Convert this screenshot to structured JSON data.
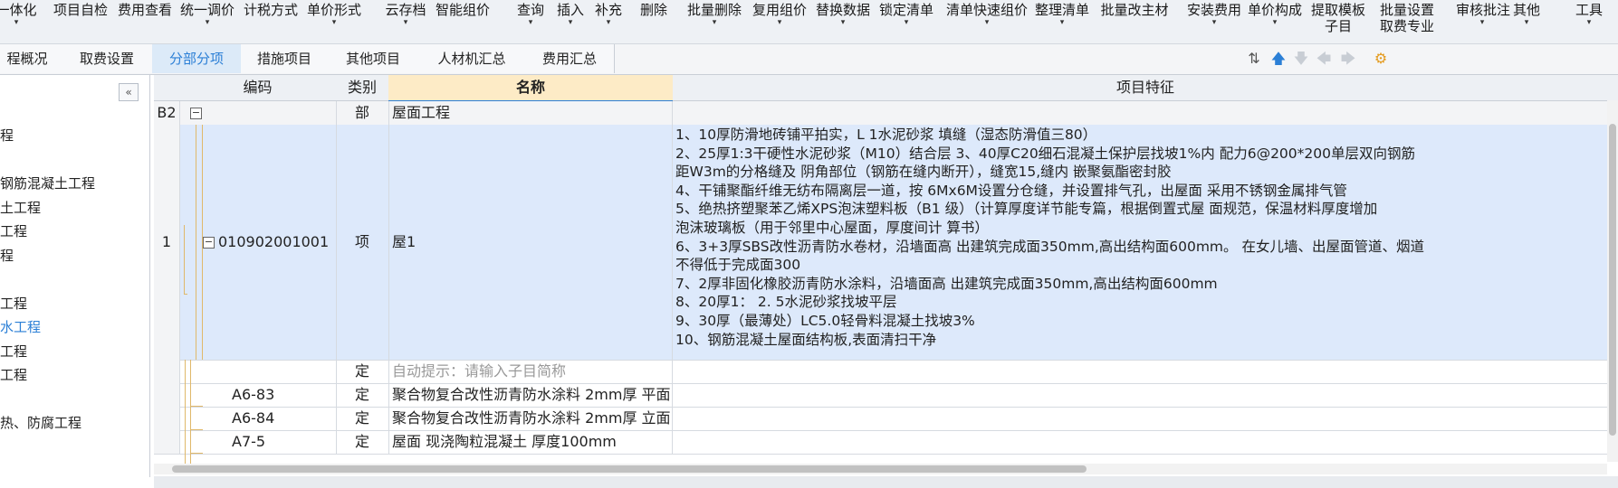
{
  "toolbar": {
    "items": [
      {
        "label": "一体化",
        "caret": true
      },
      {
        "label": "项目自检",
        "caret": false
      },
      {
        "label": "费用查看",
        "caret": false
      },
      {
        "label": "统一调价",
        "caret": true
      },
      {
        "label": "计税方式",
        "caret": false
      },
      {
        "label": "单价形式",
        "caret": true
      },
      {
        "label": "云存档",
        "caret": true
      },
      {
        "label": "智能组价",
        "caret": false
      },
      {
        "label": "查询",
        "caret": true
      },
      {
        "label": "插入",
        "caret": true
      },
      {
        "label": "补充",
        "caret": true
      },
      {
        "label": "删除",
        "caret": false
      },
      {
        "label": "批量删除",
        "caret": true
      },
      {
        "label": "复用组价",
        "caret": true
      },
      {
        "label": "替换数据",
        "caret": true
      },
      {
        "label": "锁定清单",
        "caret": true
      },
      {
        "label": "清单快速组价",
        "caret": true
      },
      {
        "label": "整理清单",
        "caret": true
      },
      {
        "label": "批量改主材",
        "caret": false
      },
      {
        "label": "安装费用",
        "caret": true
      },
      {
        "label": "单价构成",
        "caret": true
      },
      {
        "label": "提取模板",
        "label2": "子目",
        "caret": false
      },
      {
        "label": "批量设置",
        "label2": "取费专业",
        "caret": false
      },
      {
        "label": "审核批注",
        "caret": true
      },
      {
        "label": "其他",
        "caret": true
      },
      {
        "label": "工具",
        "caret": true
      }
    ]
  },
  "tabs": [
    {
      "label": "程概况",
      "active": false
    },
    {
      "label": "取费设置",
      "active": false
    },
    {
      "label": "分部分项",
      "active": true
    },
    {
      "label": "措施项目",
      "active": false
    },
    {
      "label": "其他项目",
      "active": false
    },
    {
      "label": "人材机汇总",
      "active": false
    },
    {
      "label": "费用汇总",
      "active": false
    }
  ],
  "tab_tools": {
    "sort_icon": "⇅",
    "up_icon": "🡅",
    "down_icon": "🡇",
    "left_icon": "🡄",
    "right_icon": "🡆",
    "settings_icon": "⚙"
  },
  "tree": {
    "collapse_symbol": "«",
    "items": [
      {
        "label": "程",
        "selected": false
      },
      {
        "label": "",
        "selected": false
      },
      {
        "label": "钢筋混凝土工程",
        "selected": false
      },
      {
        "label": "土工程",
        "selected": false
      },
      {
        "label": "工程",
        "selected": false
      },
      {
        "label": "程",
        "selected": false
      },
      {
        "label": "",
        "selected": false
      },
      {
        "label": "工程",
        "selected": false
      },
      {
        "label": "水工程",
        "selected": true
      },
      {
        "label": "工程",
        "selected": false
      },
      {
        "label": "工程",
        "selected": false
      },
      {
        "label": "",
        "selected": false
      },
      {
        "label": "热、防腐工程",
        "selected": false
      }
    ]
  },
  "grid": {
    "headers": {
      "code": "编码",
      "type": "类别",
      "name": "名称",
      "feature": "项目特征"
    },
    "rows": [
      {
        "num": "B2",
        "code": "",
        "type": "部",
        "name": "屋面工程",
        "kind": "section",
        "features": []
      },
      {
        "num": "1",
        "code": "010902001001",
        "type": "项",
        "name": "屋1",
        "kind": "item",
        "features": [
          "1、10厚防滑地砖铺平拍实，L 1水泥砂浆 填缝（湿态防滑值三80）",
          "2、25厚1:3干硬性水泥砂浆（M10）结合层 3、40厚C20细石混凝土保护层找坡1%内 配力6@200*200单层双向钢筋",
          "距W3m的分格缝及 阴角部位（钢筋在缝内断开），缝宽15,缝内 嵌聚氨酯密封胶",
          "4、干铺聚酯纤维无纺布隔离层一道，按 6Mx6M设置分仓缝，并设置排气孔，出屋面 采用不锈钢金属排气管",
          "5、绝热挤塑聚苯乙烯XPS泡沫塑料板（B1 级）（计算厚度详节能专篇，根据倒置式屋 面规范，保温材料厚度增加",
          "泡沫玻璃板（用于邻里中心屋面，厚度间计 算书）",
          "6、3+3厚SBS改性沥青防水卷材，沿墙面高 出建筑完成面350mm,高出结构面600mm。 在女儿墙、出屋面管道、烟道",
          "不得低于完成面300",
          "7、2厚非固化橡胶沥青防水涂料，沿墙面高 出建筑完成面350mm,高出结构面600mm",
          "8、20厚1： 2. 5水泥砂浆找坡平层",
          "9、30厚（最薄处）LC5.0轻骨料混凝土找坡3%",
          "10、钢筋混凝土屋面结构板,表面清扫干净"
        ]
      },
      {
        "num": "",
        "code": "",
        "type": "定",
        "name": "自动提示：请输入子目简称",
        "kind": "hint",
        "features": []
      },
      {
        "num": "",
        "code": "A6-83",
        "type": "定",
        "name": "聚合物复合改性沥青防水涂料 2mm厚 平面",
        "kind": "sub",
        "features": []
      },
      {
        "num": "",
        "code": "A6-84",
        "type": "定",
        "name": "聚合物复合改性沥青防水涂料 2mm厚 立面",
        "kind": "sub",
        "features": []
      },
      {
        "num": "",
        "code": "A7-5",
        "type": "定",
        "name": "屋面 现浇陶粒混凝土 厚度100mm",
        "kind": "sub",
        "features": []
      }
    ]
  },
  "colors": {
    "accent": "#2b7fd6",
    "selected_row": "#dde9fb",
    "name_header": "#fdebc6",
    "tree_line": "#e0b86a"
  }
}
